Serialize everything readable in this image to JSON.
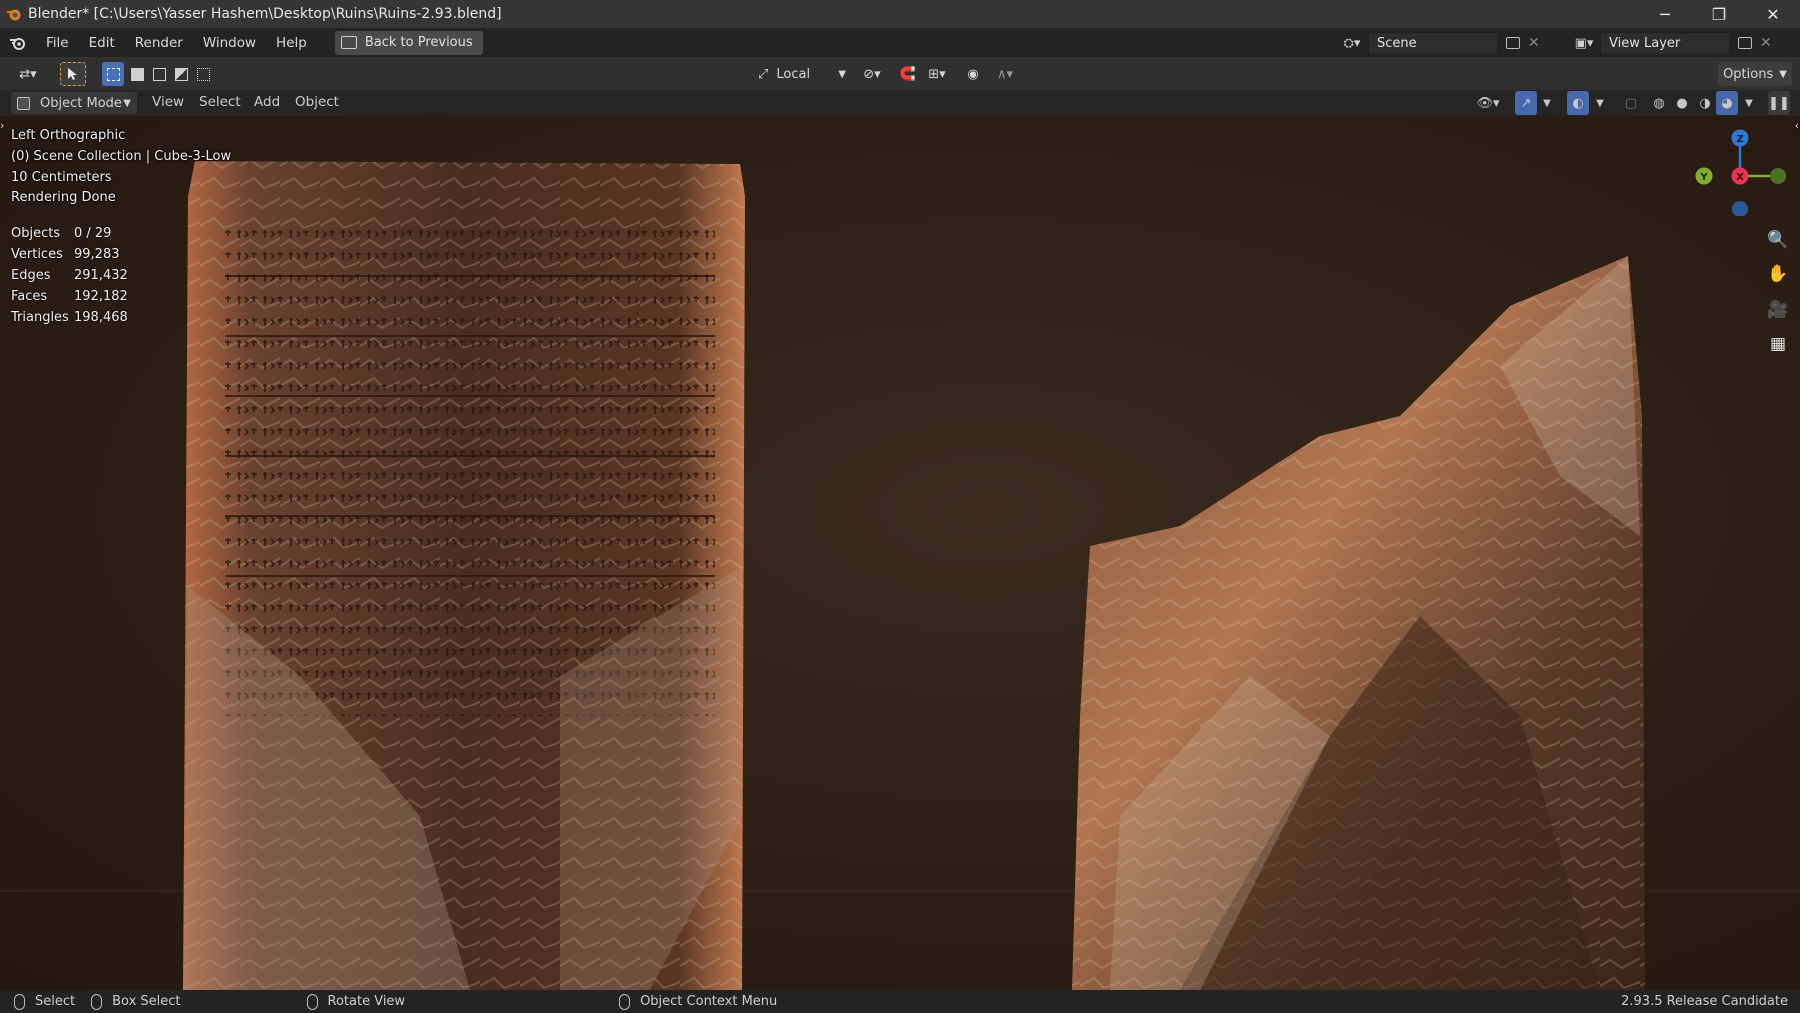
{
  "window": {
    "title": "Blender* [C:\\Users\\Yasser Hashem\\Desktop\\Ruins\\Ruins-2.93.blend]",
    "controls": [
      "─",
      "❐",
      "✕"
    ]
  },
  "menubar": {
    "items": [
      "File",
      "Edit",
      "Render",
      "Window",
      "Help"
    ],
    "back_button": "Back to Previous",
    "scene": "Scene",
    "view_layer": "View Layer"
  },
  "toolbar": {
    "transform_orientation": "Local",
    "options_label": "Options"
  },
  "viewport_header": {
    "mode": "Object Mode",
    "menus": [
      "View",
      "Select",
      "Add",
      "Object"
    ]
  },
  "viewport_info": {
    "view_name": "Left Orthographic",
    "collection": "(0) Scene Collection | Cube-3-Low",
    "scale": "10 Centimeters",
    "render_status": "Rendering Done"
  },
  "stats": [
    {
      "label": "Objects",
      "value": "0 / 29"
    },
    {
      "label": "Vertices",
      "value": "99,283"
    },
    {
      "label": "Edges",
      "value": "291,432"
    },
    {
      "label": "Faces",
      "value": "192,182"
    },
    {
      "label": "Triangles",
      "value": "198,468"
    }
  ],
  "gizmo": {
    "z": "Z",
    "y": "Y",
    "x": "X"
  },
  "statusbar": {
    "select": "Select",
    "box_select": "Box Select",
    "rotate_view": "Rotate View",
    "context_menu": "Object Context Menu",
    "version": "2.93.5 Release Candidate"
  },
  "colors": {
    "gizmo_z": "#2f7ad6",
    "gizmo_x": "#e8354e",
    "gizmo_y": "#7fb02e",
    "active_tool": "#e09a3a"
  }
}
